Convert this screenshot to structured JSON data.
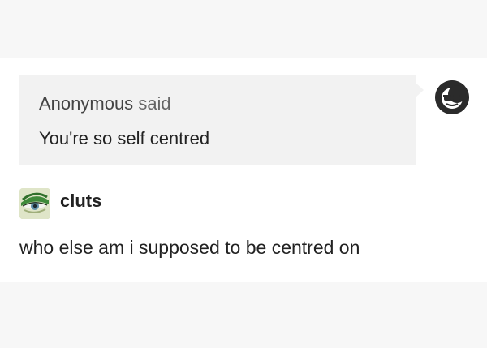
{
  "ask": {
    "asker": "Anonymous",
    "said_label": "said",
    "question": "You're so self centred",
    "asker_avatar_icon": "sunglasses-face-icon"
  },
  "reply": {
    "username": "cluts",
    "avatar_icon": "green-eye-makeup-avatar",
    "text": "who else am i supposed to be centred on"
  },
  "colors": {
    "page_background": "#f7f7f7",
    "post_background": "#ffffff",
    "ask_background": "#f2f2f2",
    "text": "#222222"
  }
}
